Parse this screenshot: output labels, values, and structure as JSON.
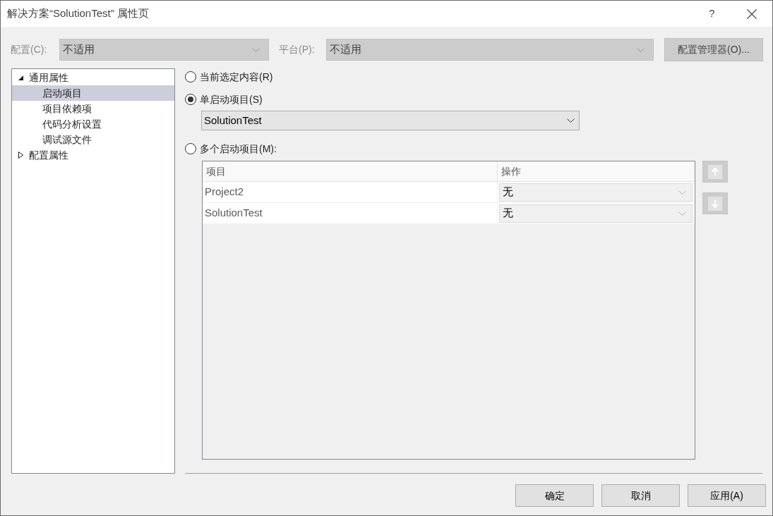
{
  "window": {
    "title": "解决方案“SolutionTest” 属性页",
    "help": "?"
  },
  "configuration": {
    "label": "配置(C):",
    "value": "不适用",
    "disabled": true
  },
  "platform": {
    "label": "平台(P):",
    "value": "不适用",
    "disabled": true
  },
  "configuration_manager": {
    "label": "配置管理器(O)...",
    "disabled": true
  },
  "tree": [
    {
      "label": "通用属性",
      "expanded": true,
      "selected": false,
      "children": [
        {
          "label": "启动项目",
          "selected": true
        },
        {
          "label": "项目依赖项",
          "selected": false
        },
        {
          "label": "代码分析设置",
          "selected": false
        },
        {
          "label": "调试源文件",
          "selected": false
        }
      ]
    },
    {
      "label": "配置属性",
      "expanded": false,
      "selected": false
    }
  ],
  "startup_options": [
    {
      "label": "当前选定内容(R)",
      "selected": false
    },
    {
      "label": "单启动项目(S)",
      "selected": true,
      "dropdown": {
        "value": "SolutionTest"
      }
    },
    {
      "label": "多个启动项目(M):",
      "selected": false,
      "grid": {
        "disabled": true,
        "columns": [
          "项目",
          "操作"
        ],
        "rows": [
          {
            "project": "Project2",
            "action": "无"
          },
          {
            "project": "SolutionTest",
            "action": "无"
          }
        ]
      },
      "move_buttons": [
        {
          "kind": "up",
          "disabled": true
        },
        {
          "kind": "down",
          "disabled": true
        }
      ]
    }
  ],
  "footer_buttons": [
    "确定",
    "取消",
    "应用(A)"
  ]
}
